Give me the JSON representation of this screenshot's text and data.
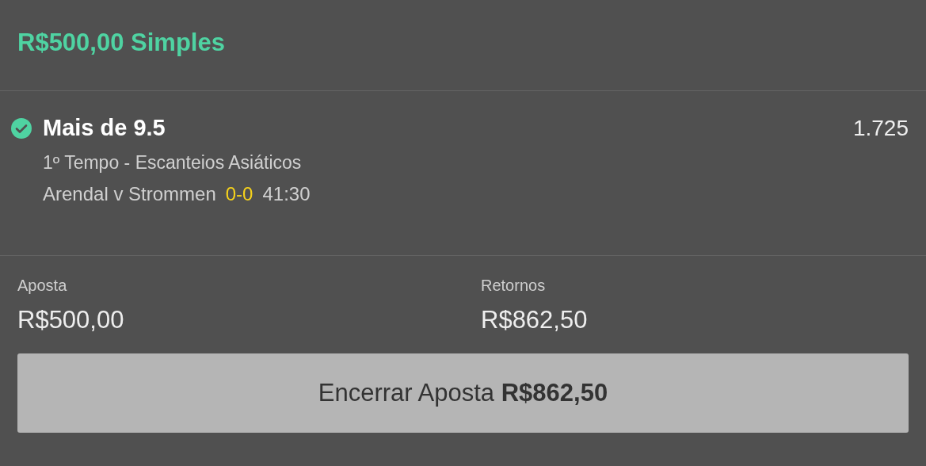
{
  "header": {
    "title": "R$500,00 Simples"
  },
  "selection": {
    "checked": true,
    "name": "Mais de 9.5",
    "odds": "1.725",
    "market": "1º Tempo - Escanteios Asiáticos",
    "match": "Arendal v Strommen",
    "score": "0-0",
    "clock": "41:30"
  },
  "summary": [
    {
      "label": "Aposta",
      "value": "R$500,00"
    },
    {
      "label": "Retornos",
      "value": "R$862,50"
    }
  ],
  "cashout_button": {
    "label": "Encerrar Aposta **R$862,50**"
  }
}
